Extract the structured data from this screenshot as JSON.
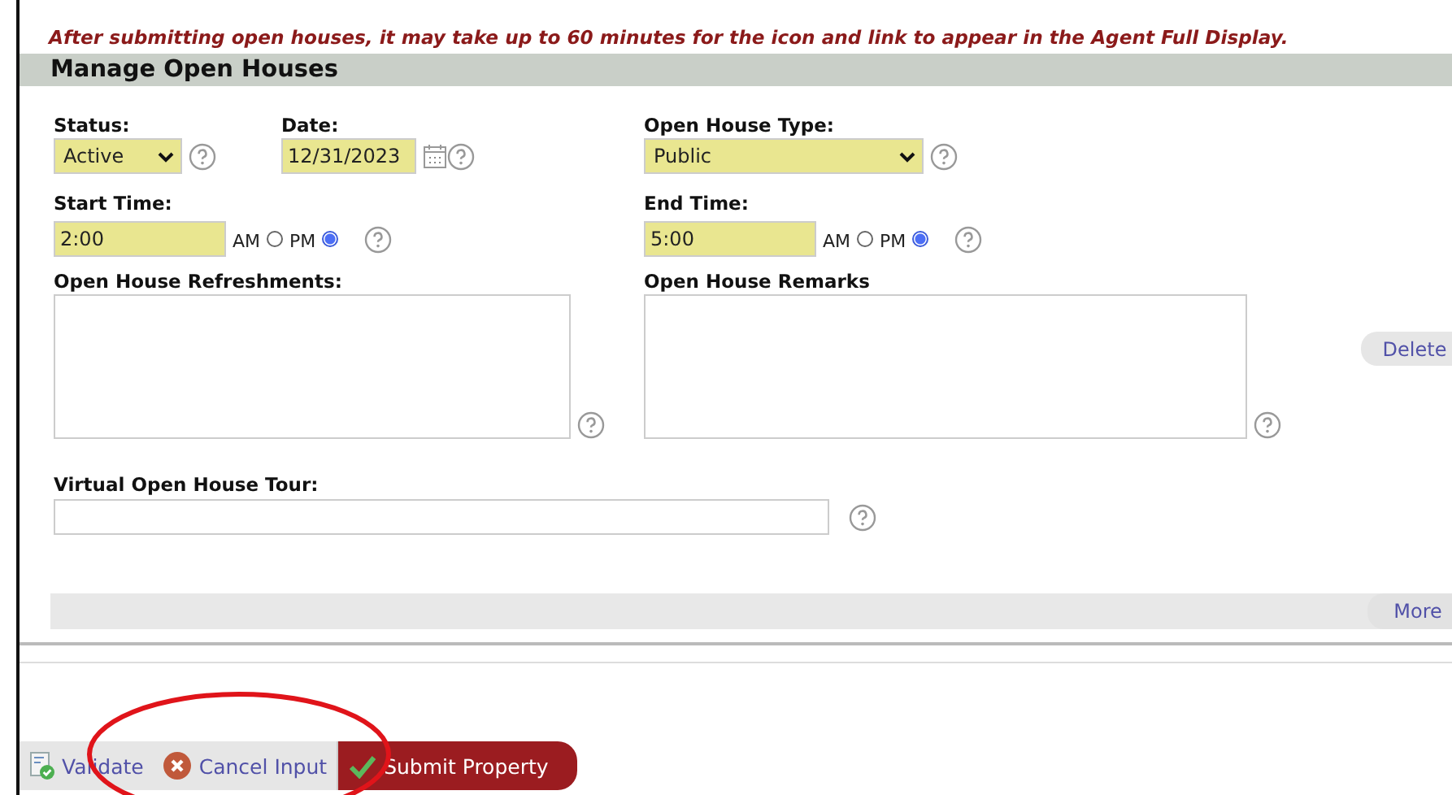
{
  "notice": "After submitting open houses, it may take up to 60 minutes for the icon and link to appear in the Agent Full Display.",
  "section_title": "Manage Open Houses",
  "status": {
    "label": "Status:",
    "value": "Active"
  },
  "date": {
    "label": "Date:",
    "value": "12/31/2023"
  },
  "open_house_type": {
    "label": "Open House Type:",
    "value": "Public"
  },
  "start_time": {
    "label": "Start Time:",
    "value": "2:00",
    "periods": [
      {
        "label": "AM",
        "selected": false
      },
      {
        "label": "PM",
        "selected": true
      }
    ]
  },
  "end_time": {
    "label": "End Time:",
    "value": "5:00",
    "periods": [
      {
        "label": "AM",
        "selected": false
      },
      {
        "label": "PM",
        "selected": true
      }
    ]
  },
  "refreshments": {
    "label": "Open House Refreshments:"
  },
  "remarks": {
    "label": "Open House Remarks"
  },
  "delete_button": "Delete",
  "virtual_tour": {
    "label": "Virtual Open House Tour:"
  },
  "more_button": "More",
  "footer_buttons": [
    {
      "label": "Validate",
      "kind": "validate"
    },
    {
      "label": "Cancel Input",
      "kind": "cancel"
    },
    {
      "label": "Submit Property",
      "kind": "submit"
    }
  ]
}
